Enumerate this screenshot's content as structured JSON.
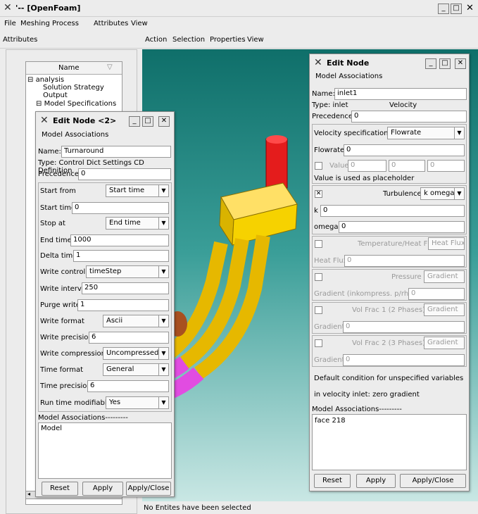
{
  "window": {
    "title": "'-- [OpenFoam]"
  },
  "menu": {
    "file": "File",
    "meshing": "Meshing Process",
    "attributes": "Attributes",
    "view": "View"
  },
  "toolbar": {
    "attributes": "Attributes",
    "action": "Action",
    "selection": "Selection",
    "properties": "Properties",
    "view": "View"
  },
  "tree": {
    "header": "Name",
    "items": [
      "analysis",
      "Solution Strategy",
      "Output",
      "Model Specifications"
    ]
  },
  "status": "No Entites have been selected",
  "dlg1": {
    "title": "Edit Node <2>",
    "section": "Model Associations",
    "name_label": "Name:",
    "name_value": "Turnaround",
    "type_text": "Type: Control Dict Settings CD Definition",
    "precedence_label": "Precedence:",
    "precedence_value": "0",
    "start_from_label": "Start from",
    "start_from_value": "Start time",
    "start_time_label": "Start time",
    "start_time_value": "0",
    "stop_at_label": "Stop at",
    "stop_at_value": "End time",
    "end_time_label": "End time",
    "end_time_value": "1000",
    "delta_time_label": "Delta time",
    "delta_time_value": "1",
    "write_control_label": "Write control",
    "write_control_value": "timeStep",
    "write_interval_label": "Write interval",
    "write_interval_value": "250",
    "purge_write_label": "Purge write",
    "purge_write_value": "1",
    "write_format_label": "Write format",
    "write_format_value": "Ascii",
    "write_precision_label": "Write precision",
    "write_precision_value": "6",
    "write_compression_label": "Write compression",
    "write_compression_value": "Uncompressed",
    "time_format_label": "Time format",
    "time_format_value": "General",
    "time_precision_label": "Time precision",
    "time_precision_value": "6",
    "runtime_mod_label": "Run time modifiable",
    "runtime_mod_value": "Yes",
    "assoc_header": "Model Associations---------",
    "assoc_item": "Model",
    "reset": "Reset",
    "apply": "Apply",
    "apply_close": "Apply/Close"
  },
  "dlg2": {
    "title": "Edit Node",
    "section": "Model Associations",
    "name_label": "Name:",
    "name_value": "inlet1",
    "type_text": "Type: inlet",
    "type_right": "Velocity",
    "precedence_label": "Precedence:",
    "precedence_value": "0",
    "vel_spec_label": "Velocity specification",
    "vel_spec_value": "Flowrate",
    "flowrate_label": "Flowrate",
    "flowrate_value": "0",
    "value_label": "Value",
    "value_vals": [
      "0",
      "0",
      "0"
    ],
    "placeholder_note": "Value is used as placeholder",
    "turb_label": "Turbulence",
    "turb_value": "k omega",
    "k_label": "k",
    "k_value": "0",
    "omega_label": "omega",
    "omega_value": "0",
    "temp_label": "Temperature/Heat Flux",
    "temp_value": "Heat Flux",
    "heatflux_label": "Heat Flux",
    "heatflux_value": "0",
    "pressure_label": "Pressure",
    "pressure_value": "Gradient",
    "grad_incomp_label": "Gradient (inkompress. p/rho))",
    "grad_incomp_value": "0",
    "volfrac1_label": "Vol Frac 1 (2 Phases)",
    "volfrac1_value": "Gradient",
    "grad1_label": "Gradient",
    "grad1_value": "0",
    "volfrac2_label": "Vol Frac 2 (3 Phases)",
    "volfrac2_value": "Gradient",
    "grad2_label": "Gradient",
    "grad2_value": "0",
    "default_note": "Default condition for unspecified variables",
    "velocity_note": "in velocity inlet: zero gradient",
    "assoc_header": "Model Associations---------",
    "assoc_item": "face 218",
    "reset": "Reset",
    "apply": "Apply",
    "apply_close": "Apply/Close"
  }
}
